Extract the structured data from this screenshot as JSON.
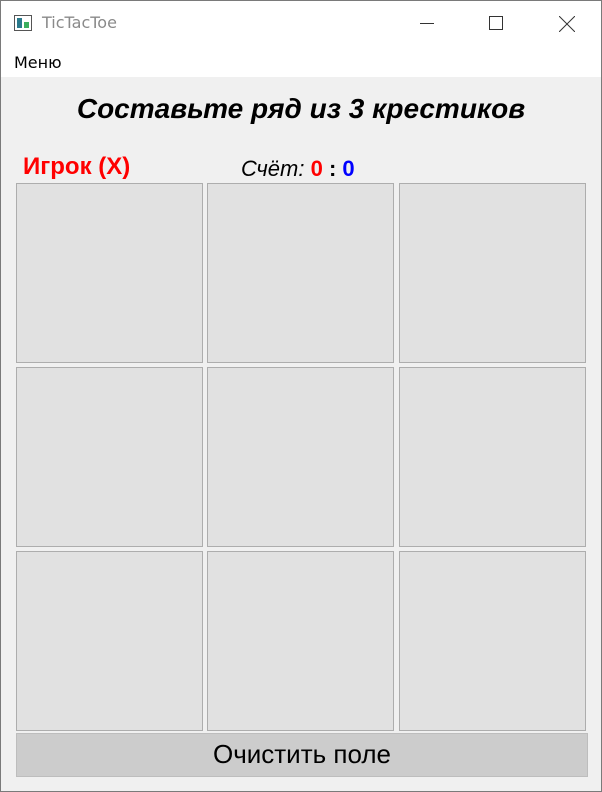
{
  "window": {
    "title": "TicTacToe",
    "icon": "app-icon",
    "controls": [
      "minimize-icon",
      "maximize-icon",
      "close-icon"
    ]
  },
  "menu": {
    "items": [
      {
        "label": "Меню"
      }
    ]
  },
  "game": {
    "heading": "Составьте ряд из 3 крестиков",
    "player_label": "Игрок (X)",
    "score_label": "Счёт:",
    "score_x": "0",
    "score_separator": ":",
    "score_o": "0",
    "cells": [
      "",
      "",
      "",
      "",
      "",
      "",
      "",
      "",
      ""
    ],
    "clear_button": "Очистить поле"
  },
  "colors": {
    "player_x": "#ff0000",
    "player_o": "#0000ff",
    "cell_background": "#e1e1e1",
    "button_background": "#cccccc",
    "window_background": "#f0f0f0"
  }
}
